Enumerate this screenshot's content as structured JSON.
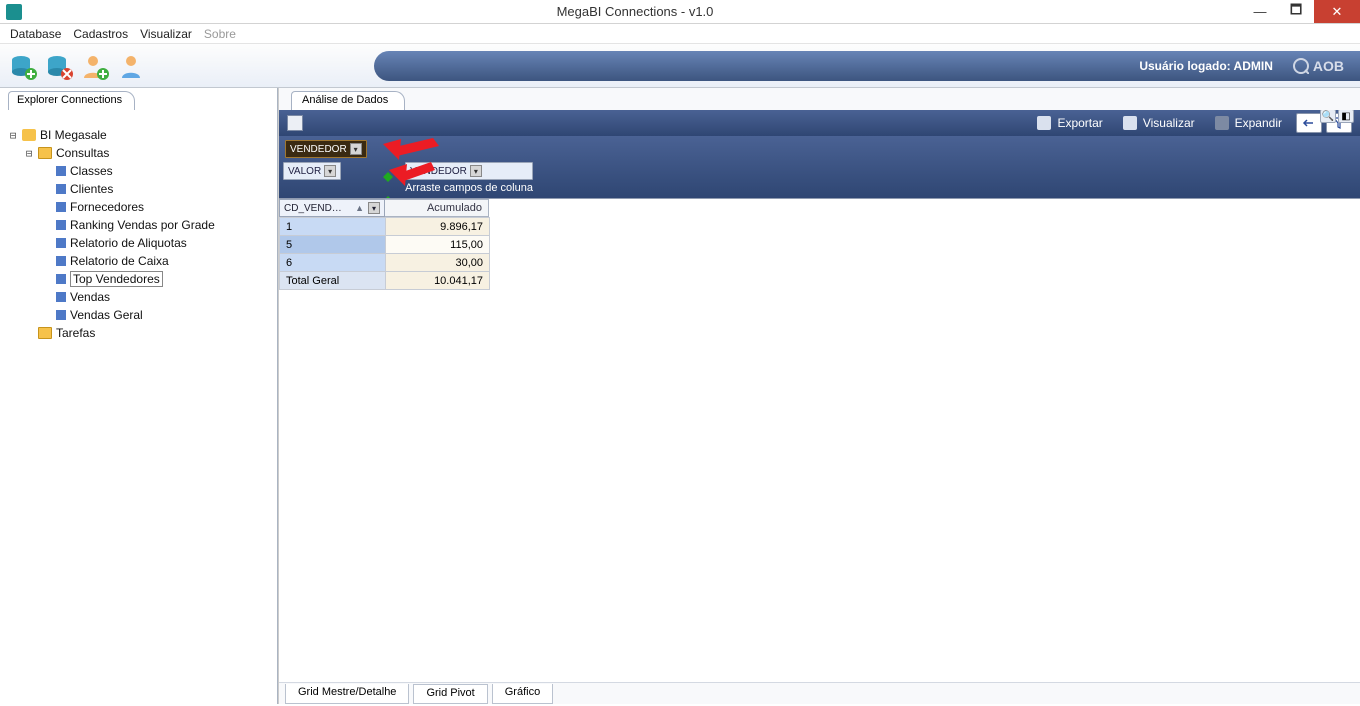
{
  "window": {
    "title": "MegaBI Connections  - v1.0"
  },
  "menu": {
    "database": "Database",
    "cadastros": "Cadastros",
    "visualizar": "Visualizar",
    "sobre": "Sobre"
  },
  "user_bar": {
    "logged_label": "Usuário logado: ADMIN",
    "brand": "AOB"
  },
  "explorer": {
    "tab": "Explorer Connections",
    "root": "BI Megasale",
    "consultas": "Consultas",
    "items": {
      "classes": "Classes",
      "clientes": "Clientes",
      "fornecedores": "Fornecedores",
      "ranking": "Ranking Vendas por Grade",
      "aliquotas": "Relatorio de Aliquotas",
      "caixa": "Relatorio de Caixa",
      "topvend": "Top Vendedores",
      "vendas": "Vendas",
      "vendasgeral": "Vendas Geral"
    },
    "tarefas": "Tarefas"
  },
  "analysis": {
    "tab": "Análise de Dados",
    "toolbar": {
      "exportar": "Exportar",
      "visualizar": "Visualizar",
      "expandir": "Expandir"
    },
    "filter_chip": "VENDEDOR",
    "data_chip": "VALOR",
    "col_chip": "VENDEDOR",
    "drag_hint": "Arraste campos de coluna",
    "rowfield": "CD_VENDEDOR",
    "valheader": "Acumulado"
  },
  "grid": {
    "rows": [
      {
        "key": "1",
        "val": "9.896,17"
      },
      {
        "key": "5",
        "val": "115,00"
      },
      {
        "key": "6",
        "val": "30,00"
      }
    ],
    "total_label": "Total Geral",
    "total_value": "10.041,17"
  },
  "bottom_tabs": {
    "mestre": "Grid Mestre/Detalhe",
    "pivot": "Grid Pivot",
    "grafico": "Gráfico"
  }
}
